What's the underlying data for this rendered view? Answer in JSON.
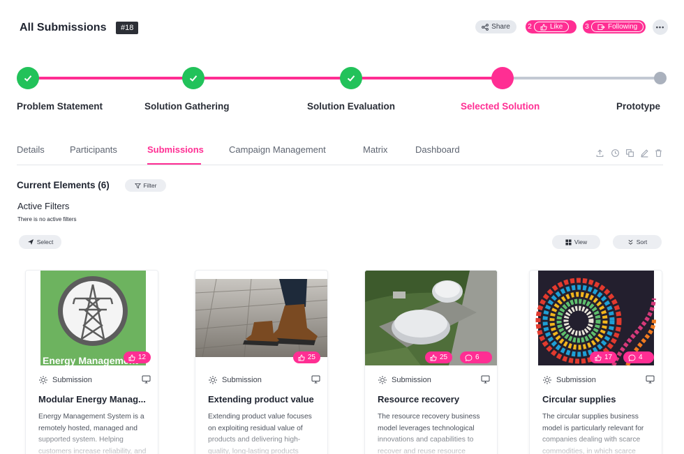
{
  "header": {
    "title": "All Submissions",
    "id_badge": "#18",
    "share_label": "Share",
    "like_count": "2",
    "like_label": "Like",
    "following_count": "3",
    "following_label": "Following",
    "more_label": "•••"
  },
  "stepper": {
    "steps": [
      {
        "label": "Problem Statement",
        "state": "done"
      },
      {
        "label": "Solution Gathering",
        "state": "done"
      },
      {
        "label": "Solution Evaluation",
        "state": "done"
      },
      {
        "label": "Selected Solution",
        "state": "current"
      },
      {
        "label": "Prototype",
        "state": "todo"
      }
    ]
  },
  "tabs": [
    {
      "label": "Details",
      "active": false
    },
    {
      "label": "Participants",
      "active": false
    },
    {
      "label": "Submissions",
      "active": true
    },
    {
      "label": "Campaign Management",
      "active": false
    },
    {
      "label": "Matrix",
      "active": false
    },
    {
      "label": "Dashboard",
      "active": false
    }
  ],
  "toolbar_icons": [
    "upload-icon",
    "clock-icon",
    "copy-icon",
    "edit-icon",
    "trash-icon"
  ],
  "elements": {
    "title": "Current Elements (6)",
    "filter_label": "Filter",
    "active_filters_title": "Active Filters",
    "no_filters_text": "There is no active filters",
    "select_label": "Select",
    "view_label": "View",
    "sort_label": "Sort"
  },
  "cards": [
    {
      "type": "Submission",
      "title": "Modular Energy Manag...",
      "description": "Energy Management System is a remotely hosted, managed and supported system. Helping customers increase reliability, and",
      "image_caption": "Energy Management",
      "likes": "12",
      "comments": null
    },
    {
      "type": "Submission",
      "title": "Extending product value",
      "description": "Extending product value focuses on exploiting residual value of products and delivering high-quality, long-lasting products",
      "likes": "25",
      "comments": null
    },
    {
      "type": "Submission",
      "title": "Resource recovery",
      "description": "The resource recovery business model leverages technological innovations and capabilities to recover and reuse resource output",
      "likes": "25",
      "comments": "6"
    },
    {
      "type": "Submission",
      "title": "Circular supplies",
      "description": "The circular supplies business model is particularly relevant for companies dealing with scarce commodities, in which scarce",
      "likes": "17",
      "comments": "4"
    }
  ],
  "colors": {
    "accent": "#ff2e93",
    "done": "#22c25a",
    "todo": "#aab1bd"
  }
}
